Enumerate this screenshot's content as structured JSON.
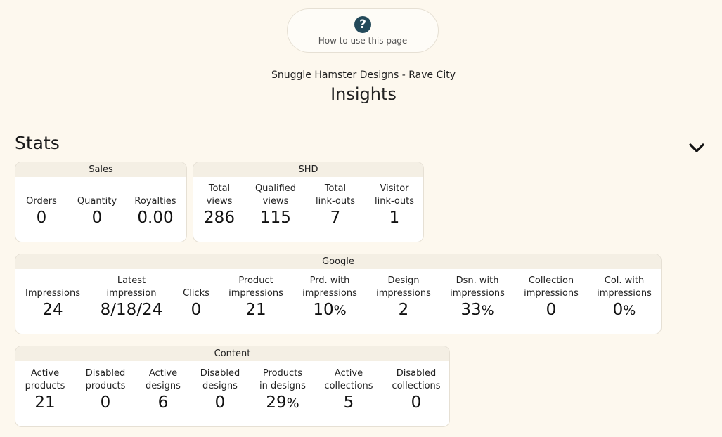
{
  "help": {
    "label": "How to use this page",
    "icon": "question-circle-icon"
  },
  "header": {
    "store": "Snuggle Hamster Designs - Rave City",
    "title": "Insights"
  },
  "stats": {
    "title": "Stats",
    "collapse_icon": "chevron-down-icon",
    "sales": {
      "title": "Sales",
      "items": [
        {
          "label": "Orders",
          "value": "0"
        },
        {
          "label": "Quantity",
          "value": "0"
        },
        {
          "label": "Royalties",
          "value": "0.00"
        }
      ]
    },
    "shd": {
      "title": "SHD",
      "items": [
        {
          "label1": "Total",
          "label2": "views",
          "value": "286"
        },
        {
          "label1": "Qualified",
          "label2": "views",
          "value": "115"
        },
        {
          "label1": "Total",
          "label2": "link-outs",
          "value": "7"
        },
        {
          "label1": "Visitor",
          "label2": "link-outs",
          "value": "1"
        }
      ]
    },
    "google": {
      "title": "Google",
      "items": [
        {
          "label1": "",
          "label2": "Impressions",
          "value": "24"
        },
        {
          "label1": "Latest",
          "label2": "impression",
          "value": "8/18/24"
        },
        {
          "label1": "",
          "label2": "Clicks",
          "value": "0"
        },
        {
          "label1": "Product",
          "label2": "impressions",
          "value": "21"
        },
        {
          "label1": "Prd. with",
          "label2": "impressions",
          "value": "10",
          "unit": "%"
        },
        {
          "label1": "Design",
          "label2": "impressions",
          "value": "2"
        },
        {
          "label1": "Dsn. with",
          "label2": "impressions",
          "value": "33",
          "unit": "%"
        },
        {
          "label1": "Collection",
          "label2": "impressions",
          "value": "0"
        },
        {
          "label1": "Col. with",
          "label2": "impressions",
          "value": "0",
          "unit": "%"
        }
      ]
    },
    "content": {
      "title": "Content",
      "items": [
        {
          "label1": "Active",
          "label2": "products",
          "value": "21"
        },
        {
          "label1": "Disabled",
          "label2": "products",
          "value": "0"
        },
        {
          "label1": "Active",
          "label2": "designs",
          "value": "6"
        },
        {
          "label1": "Disabled",
          "label2": "designs",
          "value": "0"
        },
        {
          "label1": "Products",
          "label2": "in designs",
          "value": "29",
          "unit": "%"
        },
        {
          "label1": "Active",
          "label2": "collections",
          "value": "5"
        },
        {
          "label1": "Disabled",
          "label2": "collections",
          "value": "0"
        }
      ]
    }
  }
}
